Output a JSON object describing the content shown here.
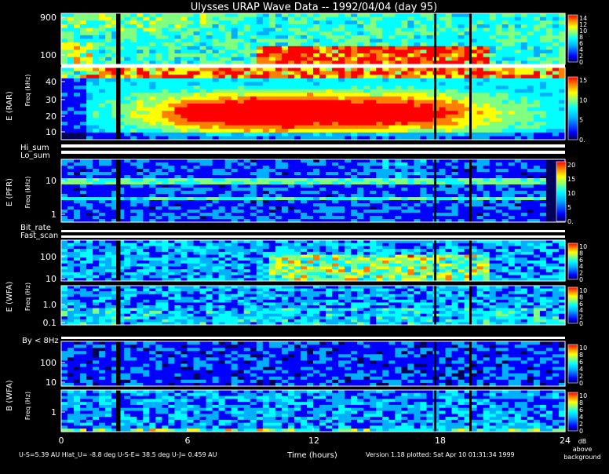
{
  "title": "Ulysses URAP Wave Data -- 1992/04/04  (day 95)",
  "chart_data": {
    "type": "heatmap",
    "xlabel": "Time (hours)",
    "xlim": [
      0,
      24
    ],
    "xticks": [
      "0",
      "6",
      "12",
      "18",
      "24"
    ],
    "panels": [
      {
        "id": "rar-high",
        "receiver_label": "E (RAR)",
        "yunit": "Freq (kHz)",
        "yticks": [
          "900",
          "100"
        ],
        "colorbar_ticks": [
          "14",
          "12",
          "10",
          "8",
          "6",
          "4",
          "2",
          "0"
        ],
        "zlim": [
          0,
          14
        ],
        "colorscale": [
          "#00005a",
          "#0000ff",
          "#00b0ff",
          "#00ffff",
          "#80ff80",
          "#ffff00",
          "#ff8000",
          "#ff0000"
        ]
      },
      {
        "id": "rar-low",
        "receiver_label": "E (RAR)",
        "yunit": "Freq (kHz)",
        "yticks": [
          "40",
          "30",
          "20",
          "10"
        ],
        "colorbar_ticks": [
          "15",
          "10",
          "5",
          "0."
        ],
        "zlim": [
          0,
          18
        ]
      },
      {
        "id": "pfr",
        "receiver_label": "E (PFR)",
        "yunit": "Freq (kHz)",
        "yticks": [
          "10",
          "1"
        ],
        "colorbar_ticks": [
          "20",
          "15",
          "10",
          "5",
          "0."
        ],
        "zlim": [
          0,
          20
        ]
      },
      {
        "id": "wfa-e-high",
        "receiver_label": "E (WFA)",
        "yunit": "Freq (Hz)",
        "yticks": [
          "100",
          "10"
        ],
        "colorbar_ticks": [
          "10",
          "8",
          "6",
          "4",
          "2",
          "0"
        ],
        "zlim": [
          0,
          10
        ]
      },
      {
        "id": "wfa-e-low",
        "receiver_label": "E (WFA)",
        "yunit": "Freq (Hz)",
        "yticks": [
          "1.0",
          "0.1"
        ],
        "colorbar_ticks": [
          "10",
          "8",
          "6",
          "4",
          "2",
          "0"
        ],
        "zlim": [
          0,
          10
        ]
      },
      {
        "id": "wfa-b-high",
        "receiver_label": "B (WFA)",
        "yunit": "Freq (Hz)",
        "yticks": [
          "100",
          "10"
        ],
        "colorbar_ticks": [
          "10",
          "8",
          "6",
          "4",
          "2",
          "0"
        ],
        "zlim": [
          0,
          10
        ]
      },
      {
        "id": "wfa-b-low",
        "receiver_label": "B (WFA)",
        "yunit": "Freq (Hz)",
        "yticks": [
          "1"
        ],
        "colorbar_ticks": [
          "10",
          "8",
          "6",
          "4",
          "2",
          "0"
        ],
        "zlim": [
          0,
          10
        ]
      }
    ],
    "strip_labels": {
      "hi_sum": "Hi_sum",
      "lo_sum": "Lo_sum",
      "bit_rate": "Bit_rate",
      "fast_scan": "Fast_scan",
      "by": "By < 8Hz"
    },
    "zlabel": [
      "dB",
      "above",
      "background"
    ]
  },
  "footer": {
    "ephemeris": "U-S=5.39 AU   Hlat_U= -8.8 deg   U-S-E= 38.5 deg   U-J= 0.459 AU",
    "version": "Version 1.18 plotted: Sat Apr 10 01:31:34 1999"
  }
}
